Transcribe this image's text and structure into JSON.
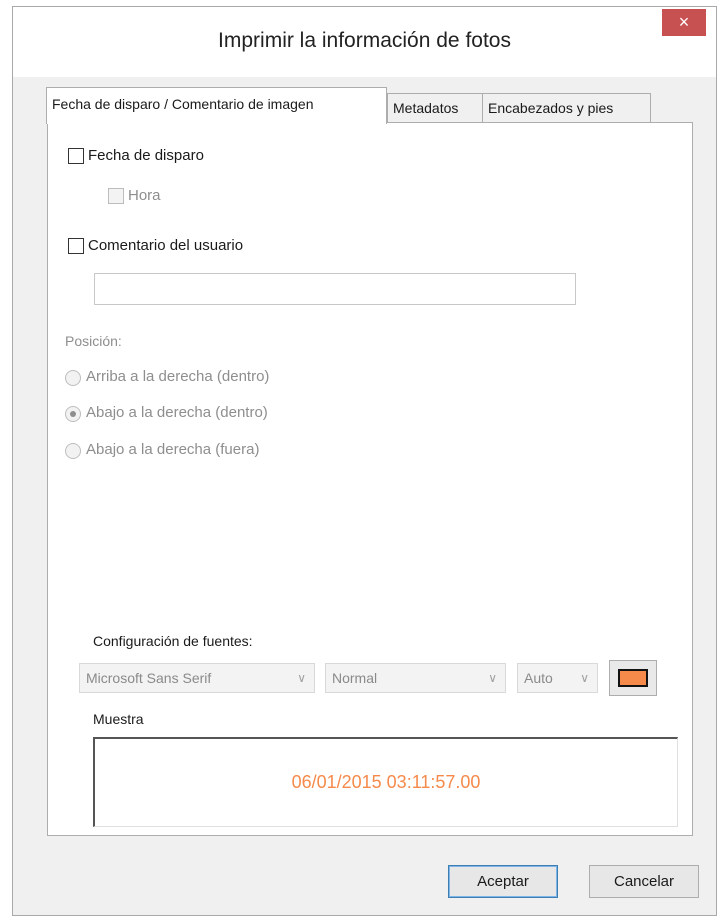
{
  "window": {
    "title": "Imprimir la información de fotos",
    "close_glyph": "×"
  },
  "tabs": [
    {
      "label": "Fecha de disparo / Comentario de imagen",
      "active": true
    },
    {
      "label": "Metadatos",
      "active": false
    },
    {
      "label": "Encabezados y pies",
      "active": false
    }
  ],
  "options": {
    "shoot_date_label": "Fecha de disparo",
    "time_label": "Hora",
    "user_comment_label": "Comentario del usuario",
    "comment_value": ""
  },
  "position": {
    "label": "Posición:",
    "options": [
      {
        "label": "Arriba a la derecha (dentro)",
        "selected": false
      },
      {
        "label": "Abajo a la derecha (dentro)",
        "selected": true
      },
      {
        "label": "Abajo a la derecha (fuera)",
        "selected": false
      }
    ]
  },
  "font": {
    "section_label": "Configuración de fuentes:",
    "family": "Microsoft Sans Serif",
    "style": "Normal",
    "size": "Auto",
    "color": "#f58a4b"
  },
  "sample": {
    "label": "Muestra",
    "text": "06/01/2015 03:11:57.00"
  },
  "buttons": {
    "ok": "Aceptar",
    "cancel": "Cancelar"
  }
}
